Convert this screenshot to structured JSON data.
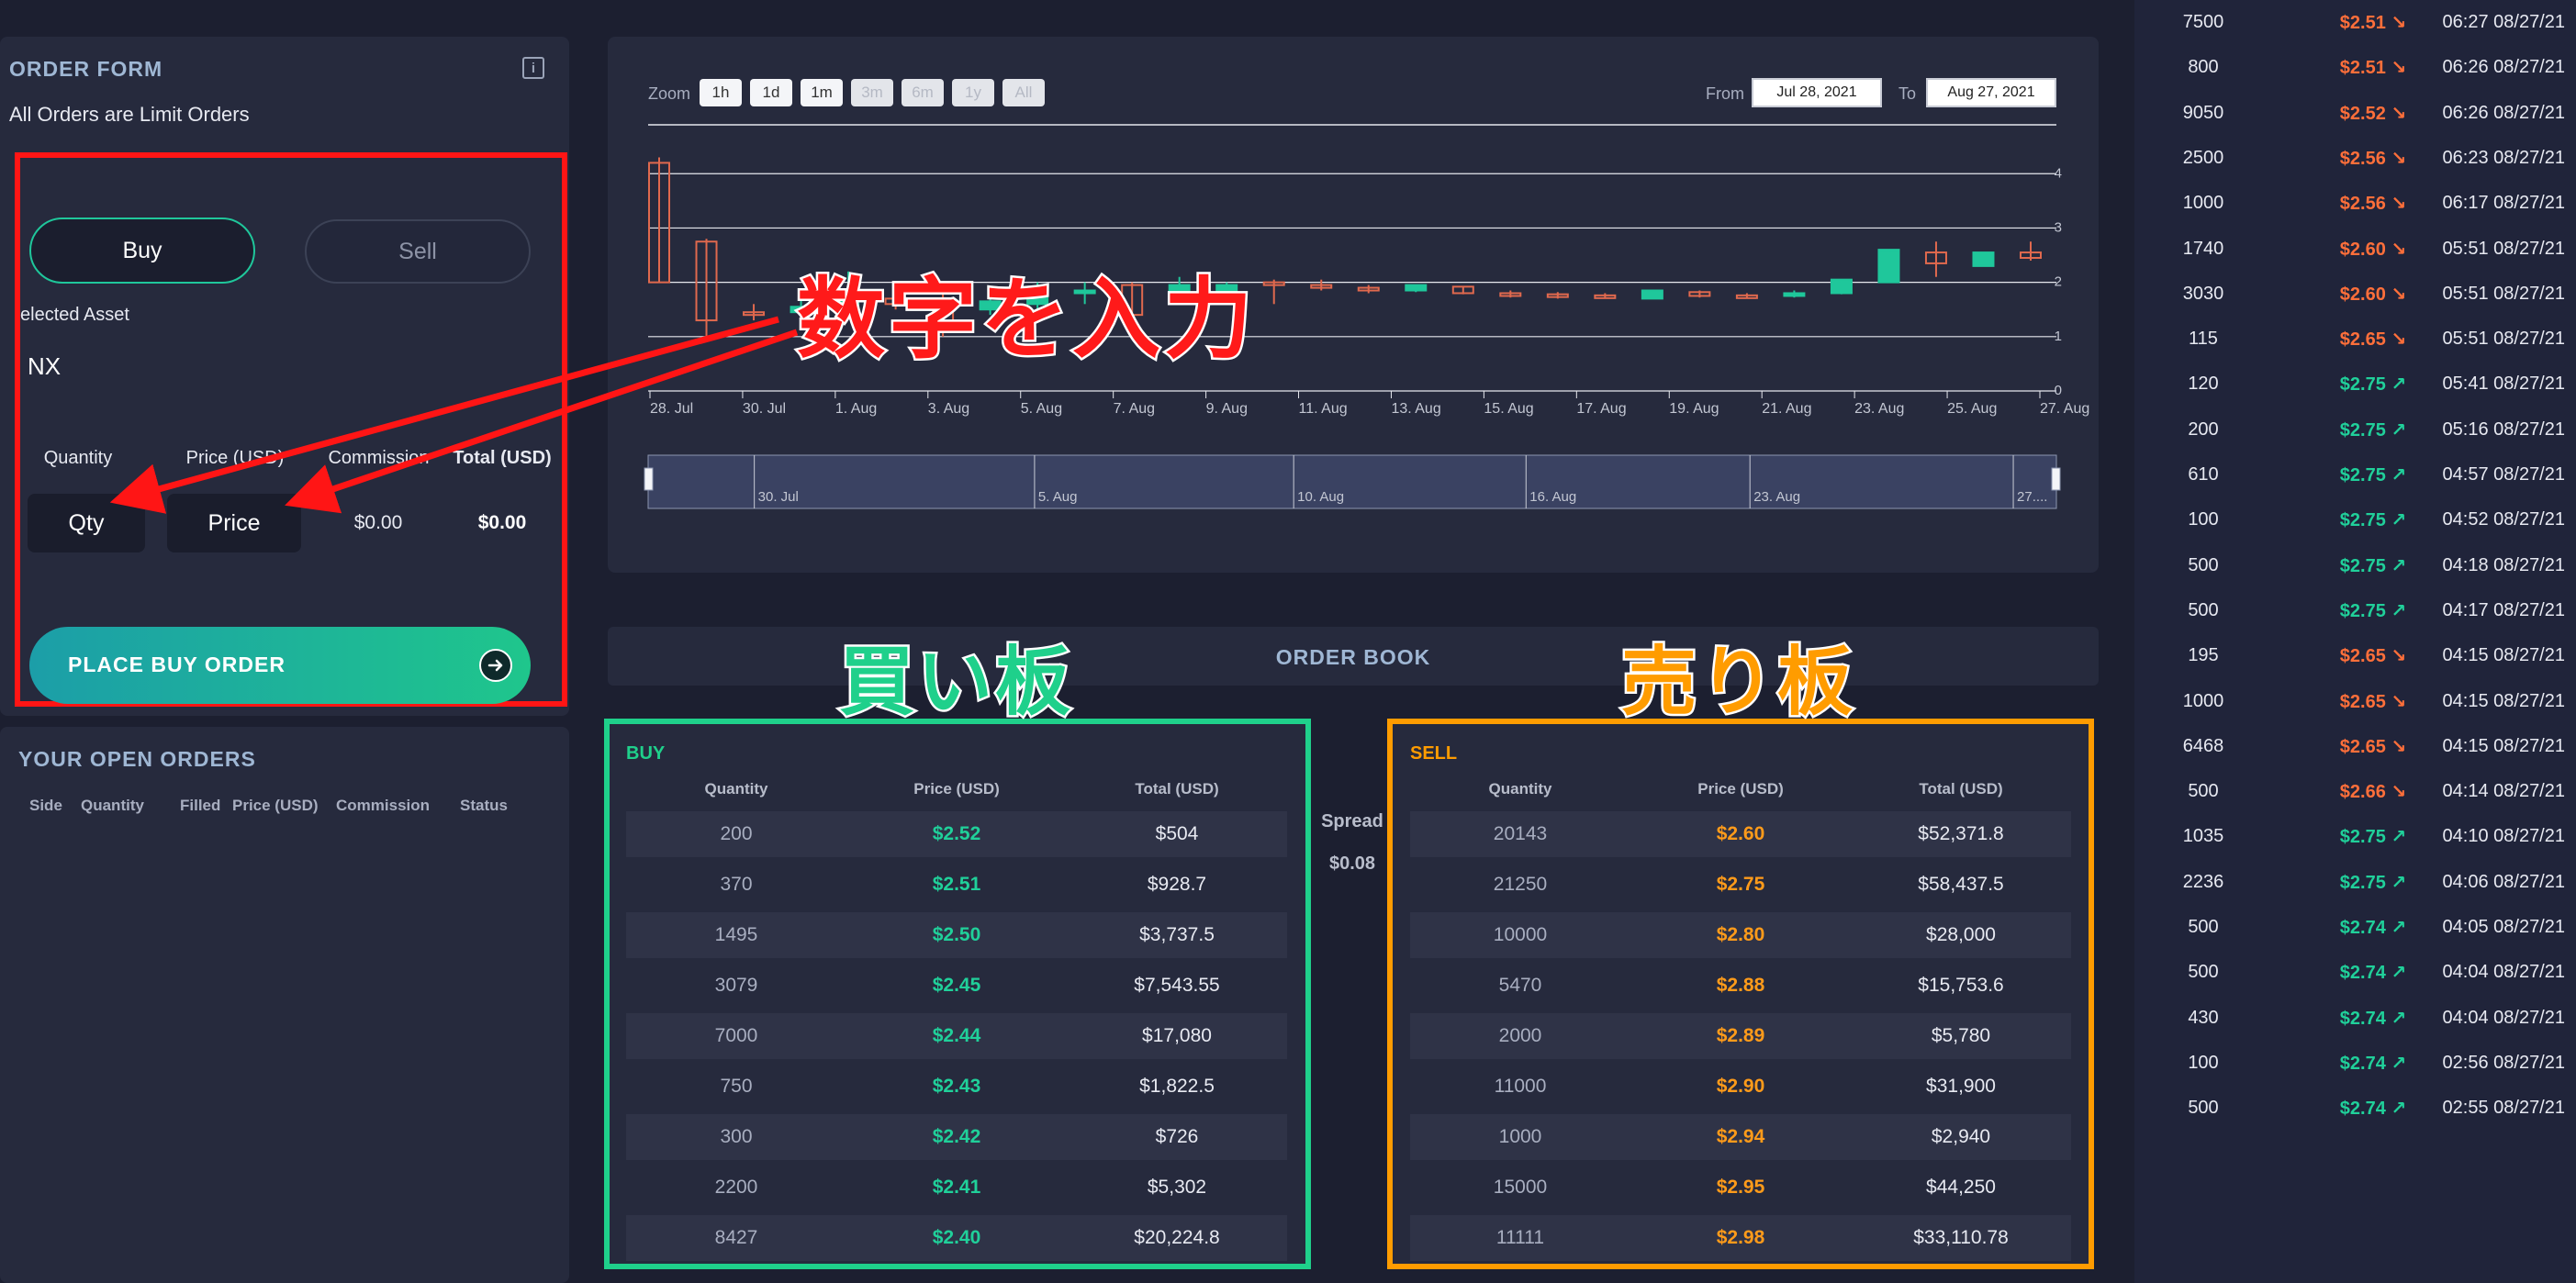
{
  "order_form": {
    "title": "ORDER FORM",
    "subtitle": "All Orders are Limit Orders",
    "info_icon": "info-icon",
    "buy_tab": "Buy",
    "sell_tab": "Sell",
    "selected_asset_label": "elected Asset",
    "selected_asset_value": "NX",
    "headers": {
      "quantity": "Quantity",
      "price": "Price (USD)",
      "commission": "Commission",
      "total": "Total (USD)"
    },
    "qty_placeholder": "Qty",
    "price_placeholder": "Price",
    "commission_value": "$0.00",
    "total_value": "$0.00",
    "place_button": "PLACE BUY ORDER",
    "place_button_icon": "arrow-right-circle-icon"
  },
  "open_orders": {
    "title": "YOUR OPEN ORDERS",
    "columns": [
      "Side",
      "Quantity",
      "Filled",
      "Price (USD)",
      "Commission",
      "Status"
    ]
  },
  "chart": {
    "zoom_label": "Zoom",
    "zoom_buttons": [
      {
        "label": "1h",
        "enabled": true
      },
      {
        "label": "1d",
        "enabled": true
      },
      {
        "label": "1m",
        "enabled": true
      },
      {
        "label": "3m",
        "enabled": false
      },
      {
        "label": "6m",
        "enabled": false
      },
      {
        "label": "1y",
        "enabled": false
      },
      {
        "label": "All",
        "enabled": false
      }
    ],
    "from_label": "From",
    "from_value": "Jul 28, 2021",
    "to_label": "To",
    "to_value": "Aug 27, 2021",
    "navigator_labels": [
      "30. Jul",
      "5. Aug",
      "10. Aug",
      "16. Aug",
      "23. Aug",
      "27...."
    ]
  },
  "chart_data": {
    "type": "candlestick",
    "title": "",
    "x_ticks": [
      "28. Jul",
      "30. Jul",
      "1. Aug",
      "3. Aug",
      "5. Aug",
      "7. Aug",
      "9. Aug",
      "11. Aug",
      "13. Aug",
      "15. Aug",
      "17. Aug",
      "19. Aug",
      "21. Aug",
      "23. Aug",
      "25. Aug",
      "27. Aug"
    ],
    "y_ticks": [
      0,
      1,
      2,
      3,
      4
    ],
    "ylim": [
      0,
      4.9
    ],
    "up_color": "#1fc79b",
    "down_color": "#e0694e",
    "candles": [
      {
        "date": "Jul 28",
        "open": 4.2,
        "close": 2.0,
        "high": 4.3,
        "low": 2.0
      },
      {
        "date": "Jul 29",
        "open": 2.75,
        "close": 1.3,
        "high": 2.8,
        "low": 1.0
      },
      {
        "date": "Jul 30",
        "open": 1.45,
        "close": 1.4,
        "high": 1.6,
        "low": 1.3
      },
      {
        "date": "Jul 31",
        "open": 1.45,
        "close": 1.55,
        "high": 1.7,
        "low": 1.4
      },
      {
        "date": "Aug 1",
        "open": 1.55,
        "close": 1.7,
        "high": 2.2,
        "low": 1.4
      },
      {
        "date": "Aug 2",
        "open": 1.7,
        "close": 1.6,
        "high": 1.9,
        "low": 1.5
      },
      {
        "date": "Aug 3",
        "open": 1.6,
        "close": 1.1,
        "high": 1.8,
        "low": 1.0
      },
      {
        "date": "Aug 4",
        "open": 1.5,
        "close": 1.65,
        "high": 1.9,
        "low": 1.4
      },
      {
        "date": "Aug 5",
        "open": 1.6,
        "close": 1.9,
        "high": 2.0,
        "low": 1.4
      },
      {
        "date": "Aug 6",
        "open": 1.8,
        "close": 1.85,
        "high": 2.0,
        "low": 1.6
      },
      {
        "date": "Aug 7",
        "open": 1.95,
        "close": 1.4,
        "high": 2.0,
        "low": 1.3
      },
      {
        "date": "Aug 8",
        "open": 1.85,
        "close": 1.95,
        "high": 2.1,
        "low": 1.7
      },
      {
        "date": "Aug 9",
        "open": 1.75,
        "close": 1.95,
        "high": 2.0,
        "low": 1.7
      },
      {
        "date": "Aug 11",
        "open": 2.0,
        "close": 1.95,
        "high": 2.05,
        "low": 1.6
      },
      {
        "date": "Aug 12",
        "open": 1.95,
        "close": 1.9,
        "high": 2.05,
        "low": 1.85
      },
      {
        "date": "Aug 13",
        "open": 1.9,
        "close": 1.88,
        "high": 1.95,
        "low": 1.8
      },
      {
        "date": "Aug 14",
        "open": 1.85,
        "close": 1.95,
        "high": 1.95,
        "low": 1.82
      },
      {
        "date": "Aug 15",
        "open": 1.92,
        "close": 1.8,
        "high": 1.93,
        "low": 1.78
      },
      {
        "date": "Aug 16",
        "open": 1.8,
        "close": 1.75,
        "high": 1.85,
        "low": 1.72
      },
      {
        "date": "Aug 17",
        "open": 1.78,
        "close": 1.75,
        "high": 1.82,
        "low": 1.7
      },
      {
        "date": "Aug 18",
        "open": 1.76,
        "close": 1.74,
        "high": 1.8,
        "low": 1.7
      },
      {
        "date": "Aug 19",
        "open": 1.7,
        "close": 1.85,
        "high": 1.85,
        "low": 1.7
      },
      {
        "date": "Aug 20",
        "open": 1.82,
        "close": 1.75,
        "high": 1.85,
        "low": 1.72
      },
      {
        "date": "Aug 21",
        "open": 1.76,
        "close": 1.74,
        "high": 1.8,
        "low": 1.7
      },
      {
        "date": "Aug 22",
        "open": 1.75,
        "close": 1.8,
        "high": 1.85,
        "low": 1.72
      },
      {
        "date": "Aug 23",
        "open": 1.8,
        "close": 2.05,
        "high": 2.05,
        "low": 1.78
      },
      {
        "date": "Aug 24",
        "open": 2.0,
        "close": 2.6,
        "high": 2.6,
        "low": 2.0
      },
      {
        "date": "Aug 25",
        "open": 2.55,
        "close": 2.35,
        "high": 2.75,
        "low": 2.1
      },
      {
        "date": "Aug 26",
        "open": 2.3,
        "close": 2.55,
        "high": 2.55,
        "low": 2.3
      },
      {
        "date": "Aug 27",
        "open": 2.55,
        "close": 2.45,
        "high": 2.75,
        "low": 2.4
      }
    ]
  },
  "order_book": {
    "title": "ORDER BOOK",
    "spread_label": "Spread",
    "spread_value": "$0.08",
    "buy": {
      "title": "BUY",
      "columns": [
        "Quantity",
        "Price (USD)",
        "Total (USD)"
      ],
      "rows": [
        [
          "200",
          "$2.52",
          "$504"
        ],
        [
          "370",
          "$2.51",
          "$928.7"
        ],
        [
          "1495",
          "$2.50",
          "$3,737.5"
        ],
        [
          "3079",
          "$2.45",
          "$7,543.55"
        ],
        [
          "7000",
          "$2.44",
          "$17,080"
        ],
        [
          "750",
          "$2.43",
          "$1,822.5"
        ],
        [
          "300",
          "$2.42",
          "$726"
        ],
        [
          "2200",
          "$2.41",
          "$5,302"
        ],
        [
          "8427",
          "$2.40",
          "$20,224.8"
        ]
      ]
    },
    "sell": {
      "title": "SELL",
      "columns": [
        "Quantity",
        "Price (USD)",
        "Total (USD)"
      ],
      "rows": [
        [
          "20143",
          "$2.60",
          "$52,371.8"
        ],
        [
          "21250",
          "$2.75",
          "$58,437.5"
        ],
        [
          "10000",
          "$2.80",
          "$28,000"
        ],
        [
          "5470",
          "$2.88",
          "$15,753.6"
        ],
        [
          "2000",
          "$2.89",
          "$5,780"
        ],
        [
          "11000",
          "$2.90",
          "$31,900"
        ],
        [
          "1000",
          "$2.94",
          "$2,940"
        ],
        [
          "15000",
          "$2.95",
          "$44,250"
        ],
        [
          "11111",
          "$2.98",
          "$33,110.78"
        ]
      ]
    }
  },
  "trades": [
    {
      "qty": "7500",
      "price": "$2.51",
      "dir": "down",
      "time": "06:27 08/27/21"
    },
    {
      "qty": "800",
      "price": "$2.51",
      "dir": "down",
      "time": "06:26 08/27/21"
    },
    {
      "qty": "9050",
      "price": "$2.52",
      "dir": "down",
      "time": "06:26 08/27/21"
    },
    {
      "qty": "2500",
      "price": "$2.56",
      "dir": "down",
      "time": "06:23 08/27/21"
    },
    {
      "qty": "1000",
      "price": "$2.56",
      "dir": "down",
      "time": "06:17 08/27/21"
    },
    {
      "qty": "1740",
      "price": "$2.60",
      "dir": "down",
      "time": "05:51 08/27/21"
    },
    {
      "qty": "3030",
      "price": "$2.60",
      "dir": "down",
      "time": "05:51 08/27/21"
    },
    {
      "qty": "115",
      "price": "$2.65",
      "dir": "down",
      "time": "05:51 08/27/21"
    },
    {
      "qty": "120",
      "price": "$2.75",
      "dir": "up",
      "time": "05:41 08/27/21"
    },
    {
      "qty": "200",
      "price": "$2.75",
      "dir": "up",
      "time": "05:16 08/27/21"
    },
    {
      "qty": "610",
      "price": "$2.75",
      "dir": "up",
      "time": "04:57 08/27/21"
    },
    {
      "qty": "100",
      "price": "$2.75",
      "dir": "up",
      "time": "04:52 08/27/21"
    },
    {
      "qty": "500",
      "price": "$2.75",
      "dir": "up",
      "time": "04:18 08/27/21"
    },
    {
      "qty": "500",
      "price": "$2.75",
      "dir": "up",
      "time": "04:17 08/27/21"
    },
    {
      "qty": "195",
      "price": "$2.65",
      "dir": "down",
      "time": "04:15 08/27/21"
    },
    {
      "qty": "1000",
      "price": "$2.65",
      "dir": "down",
      "time": "04:15 08/27/21"
    },
    {
      "qty": "6468",
      "price": "$2.65",
      "dir": "down",
      "time": "04:15 08/27/21"
    },
    {
      "qty": "500",
      "price": "$2.66",
      "dir": "down",
      "time": "04:14 08/27/21"
    },
    {
      "qty": "1035",
      "price": "$2.75",
      "dir": "up",
      "time": "04:10 08/27/21"
    },
    {
      "qty": "2236",
      "price": "$2.75",
      "dir": "up",
      "time": "04:06 08/27/21"
    },
    {
      "qty": "500",
      "price": "$2.74",
      "dir": "up",
      "time": "04:05 08/27/21"
    },
    {
      "qty": "500",
      "price": "$2.74",
      "dir": "up",
      "time": "04:04 08/27/21"
    },
    {
      "qty": "430",
      "price": "$2.74",
      "dir": "up",
      "time": "04:04 08/27/21"
    },
    {
      "qty": "100",
      "price": "$2.74",
      "dir": "up",
      "time": "02:56 08/27/21"
    },
    {
      "qty": "500",
      "price": "$2.74",
      "dir": "up",
      "time": "02:55 08/27/21"
    }
  ],
  "annotations": {
    "input_numbers": "数字を入力",
    "buy_board": "買い板",
    "sell_board": "売り板",
    "colors": {
      "red": "#ff1515",
      "green": "#1fd08b",
      "orange": "#ff9c00"
    }
  }
}
